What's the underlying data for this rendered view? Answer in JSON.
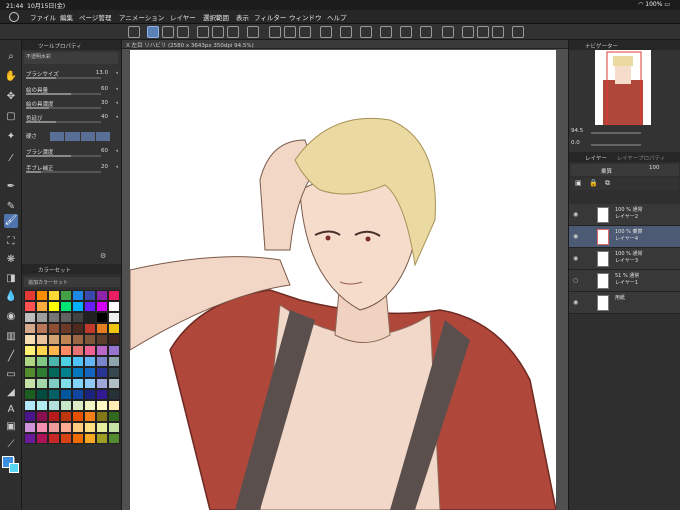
{
  "statusbar": {
    "time": "21:44",
    "date": "10月15日(金)",
    "battery": "100%"
  },
  "menu": [
    "ファイル",
    "編集",
    "ページ管理",
    "アニメーション",
    "レイヤー",
    "選択範囲",
    "表示",
    "フィルター",
    "ウィンドウ",
    "ヘルプ"
  ],
  "toolprop": {
    "title": "ツールプロパティ",
    "subtitle": "不透明水彩",
    "rows": [
      {
        "label": "ブラシサイズ",
        "value": "13.0",
        "fill": 0.4
      },
      {
        "label": "絵の具量",
        "value": "60",
        "fill": 0.6
      },
      {
        "label": "絵の具濃度",
        "value": "30",
        "fill": 0.3
      },
      {
        "label": "色延び",
        "value": "40",
        "fill": 0.4
      },
      {
        "label": "硬さ",
        "value": "",
        "fill": 0.0
      },
      {
        "label": "ブラシ濃度",
        "value": "60",
        "fill": 0.6
      },
      {
        "label": "手ブレ補正",
        "value": "20",
        "fill": 0.2
      }
    ]
  },
  "colorset": {
    "tab": "カラーセット",
    "name": "追加カラーセット",
    "swatches": [
      "#e53935",
      "#fb8c00",
      "#fdd835",
      "#43a047",
      "#1e88e5",
      "#3949ab",
      "#8e24aa",
      "#e91e63",
      "#ff5252",
      "#ffab40",
      "#ffff00",
      "#00e676",
      "#00b0ff",
      "#651fff",
      "#d500f9",
      "#ffffff",
      "#bdbdbd",
      "#9e9e9e",
      "#757575",
      "#616161",
      "#424242",
      "#212121",
      "#000000",
      "#eeeeee",
      "#d7a98c",
      "#b9775a",
      "#8d4e35",
      "#6d3a2a",
      "#4e2a1e",
      "#c0392b",
      "#e67e22",
      "#f1c40f",
      "#f5deb3",
      "#e8c39e",
      "#d4a373",
      "#c08552",
      "#9c6644",
      "#7f5539",
      "#5c3d2e",
      "#3e2723",
      "#fff176",
      "#ffd54f",
      "#ffb74d",
      "#ff8a65",
      "#e57373",
      "#f06292",
      "#ba68c8",
      "#9575cd",
      "#aed581",
      "#81c784",
      "#4db6ac",
      "#4dd0e1",
      "#4fc3f7",
      "#64b5f6",
      "#7986cb",
      "#90a4ae",
      "#558b2f",
      "#2e7d32",
      "#00695c",
      "#00838f",
      "#0277bd",
      "#1565c0",
      "#283593",
      "#37474f",
      "#c5e1a5",
      "#a5d6a7",
      "#80cbc4",
      "#80deea",
      "#81d4fa",
      "#90caf9",
      "#9fa8da",
      "#b0bec5",
      "#1b5e20",
      "#004d40",
      "#006064",
      "#01579b",
      "#0d47a1",
      "#1a237e",
      "#311b92",
      "#263238",
      "#b3e5fc",
      "#b2ebf2",
      "#b2dfdb",
      "#c8e6c9",
      "#dcedc8",
      "#f0f4c3",
      "#fff9c4",
      "#ffecb3",
      "#4a148c",
      "#880e4f",
      "#b71c1c",
      "#bf360c",
      "#e65100",
      "#f57f17",
      "#827717",
      "#33691e",
      "#ce93d8",
      "#f48fb1",
      "#ef9a9a",
      "#ffab91",
      "#ffcc80",
      "#ffe082",
      "#e6ee9c",
      "#c5e1a5",
      "#6a1b9a",
      "#ad1457",
      "#c62828",
      "#d84315",
      "#ef6c00",
      "#f9a825",
      "#9e9d24",
      "#558b2f"
    ]
  },
  "canvas": {
    "tab": "X 左目 リハビリ (2580 x 3643px 350dpi 94.5%)"
  },
  "navigator": {
    "title": "ナビゲーター",
    "zoom": "94.5",
    "angle": "0.0"
  },
  "layers": {
    "tab": "レイヤー",
    "tab2": "レイヤープロパティ",
    "blend": "乗算",
    "opacity": "100",
    "items": [
      {
        "mode": "100 % 通常",
        "name": "レイヤー2"
      },
      {
        "mode": "100 % 乗算",
        "name": "レイヤー4"
      },
      {
        "mode": "100 % 通常",
        "name": "レイヤー3"
      },
      {
        "mode": "51 % 通常",
        "name": "レイヤー1"
      },
      {
        "mode": "",
        "name": "用紙"
      }
    ]
  },
  "colors": {
    "accent": "#5a7fb3",
    "main_color": "#3b8fe0",
    "sub_color": "#5ad5f5"
  }
}
